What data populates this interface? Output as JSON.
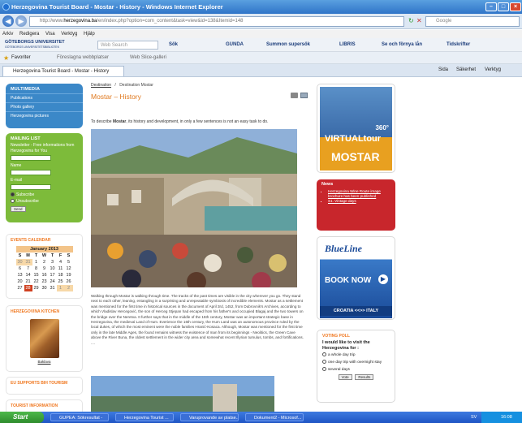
{
  "window": {
    "title": "Herzegovina Tourist Board - Mostar - History - Windows Internet Explorer"
  },
  "address_bar": {
    "url_prefix": "http://www.",
    "url_domain": "herzegovina.ba",
    "url_rest": "/en/index.php?option=com_content&task=view&id=138&Itemid=148",
    "search_placeholder": "Google"
  },
  "menu": [
    "Arkiv",
    "Redigera",
    "Visa",
    "Verktyg",
    "Hjälp"
  ],
  "toolbar": {
    "brand": "GÖTEBORGS UNIVERSITET",
    "brand_sub": "GÖTEBORGS UNIVERSITETSBIBLIOTEK",
    "search": "Web Search",
    "sok": "Sök",
    "gunda": "GUNDA",
    "summon": "Summon supersök",
    "libris": "LIBRIS",
    "fornya": "Se och förnya lån",
    "tidskrifter": "Tidskrifter"
  },
  "favbar": {
    "favorites": "Favoriter",
    "suggested": "Föreslagna webbplatser",
    "gallery": "Web Slice-galleri"
  },
  "tab": {
    "label": "Herzegovina Tourist Board - Mostar - History"
  },
  "ie_commands": {
    "page": "Sida",
    "safety": "Säkerhet",
    "tools": "Verktyg"
  },
  "multimedia": {
    "title": "MULTIMEDIA",
    "items": [
      "Publications",
      "Photo gallery",
      "Herzegovina pictures"
    ]
  },
  "mailing": {
    "title": "MAILING LIST",
    "desc": "Newsletter - Free informations from Herzegovina for You",
    "name_label": "Name",
    "email_label": "E-mail",
    "subscribe": "Subscribe",
    "unsubscribe": "Unsubscribe",
    "button": "Send"
  },
  "calendar": {
    "title": "EVENTS CALENDAR",
    "month": "January 2013",
    "headers": [
      "S",
      "M",
      "T",
      "W",
      "T",
      "F",
      "S"
    ],
    "rows": [
      [
        "30",
        "31",
        "1",
        "2",
        "3",
        "4",
        "5"
      ],
      [
        "6",
        "7",
        "8",
        "9",
        "10",
        "11",
        "12"
      ],
      [
        "13",
        "14",
        "15",
        "16",
        "17",
        "18",
        "19"
      ],
      [
        "20",
        "21",
        "22",
        "23",
        "24",
        "25",
        "26"
      ],
      [
        "27",
        "28",
        "29",
        "30",
        "31",
        "1",
        "2"
      ]
    ]
  },
  "kitchen": {
    "title": "HERZEGOVINA KITCHEN",
    "caption": "Baklava"
  },
  "eu": {
    "title": "EU SUPPORTS BIH TOURISM"
  },
  "tourist_info": {
    "title": "TOURIST INFORMATION"
  },
  "main": {
    "breadcrumb_root": "Destination",
    "breadcrumb_sep": "/",
    "breadcrumb_leaf": "Destination Mostar",
    "heading": "Mostar – History",
    "intro_pre": "To describe ",
    "intro_bold": "Mostar",
    "intro_post": ", its history and development, in only a few sentences is not an easy task to do.",
    "body": "Walking through Mostar is walking through time. The tracks of the past times are visible in the city wherever you go. They stand next to each other, leaning, entangling in a surprising and unrepeatable symbiosis of incredible elements. Mostar as a settlement was mentioned for the first time in historical sources in the document of April 3rd, 1452, from Dubrovnik's Archives, according to which Vladislav Hercegović, the son of Herceg Stjepan had escaped from his father's and occupied Blagaj and the two towers on the bridge over the Neretva. It further says that in the middle of the 15th century, Mostar was an important strategic base in Herzegovina, the medieval Land of Hum. Everience the 16th century, the Hum Land was an autonomous province ruled by the local dukes, of which the most eminent were the noble families Hranić-Kosaca. Although, Mostar was mentioned for the first time only in the late Middle Ages, the found remains witness the existence of man from its beginnings - Neolitics, the Green Cave above the River Buna, the oldest settlement in the wider city area and somewhat recent Illyrian tumulus, tombs, and fortifications. ...."
  },
  "ad_virtual": {
    "line1": "VIRTUALtour",
    "line2": "MOSTAR",
    "badge": "360°"
  },
  "news": {
    "title": "News",
    "items": [
      "Herzegovina Wine Route image brochure has been published",
      "S1. Vintage days"
    ]
  },
  "ad_blueline": {
    "brand": "BlueLine",
    "cta": "BOOK NOW",
    "route": "CROATIA <<>> ITALY"
  },
  "poll": {
    "title": "VOTING POLL",
    "question": "I would like to visit the Herzegovina for :",
    "options": [
      "a whole day trip",
      "one day trip with overnight stay",
      "several days"
    ],
    "vote": "Vote",
    "results": "Results"
  },
  "taskbar": {
    "start": "Start",
    "tasks": [
      "GUPEA: Sökresultat -",
      "Herzegovina Tourist ...",
      "Varuprovande av platse...",
      "Dokument2 - Microsof..."
    ],
    "lang": "SV",
    "clock": "16:08"
  }
}
